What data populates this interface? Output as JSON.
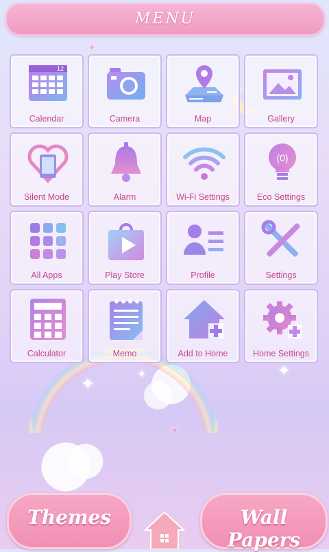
{
  "header": {
    "title": "MENU"
  },
  "tiles": [
    {
      "label": "Calendar",
      "icon": "calendar-icon",
      "badge": "12"
    },
    {
      "label": "Camera",
      "icon": "camera-icon"
    },
    {
      "label": "Map",
      "icon": "map-icon"
    },
    {
      "label": "Gallery",
      "icon": "gallery-icon"
    },
    {
      "label": "Silent Mode",
      "icon": "silent-mode-icon"
    },
    {
      "label": "Alarm",
      "icon": "alarm-bell-icon"
    },
    {
      "label": "Wi-Fi Settings",
      "icon": "wifi-icon"
    },
    {
      "label": "Eco Settings",
      "icon": "eco-bulb-icon"
    },
    {
      "label": "All Apps",
      "icon": "all-apps-icon"
    },
    {
      "label": "Play Store",
      "icon": "play-store-icon"
    },
    {
      "label": "Profile",
      "icon": "profile-icon"
    },
    {
      "label": "Settings",
      "icon": "settings-tools-icon"
    },
    {
      "label": "Calculator",
      "icon": "calculator-icon"
    },
    {
      "label": "Memo",
      "icon": "memo-icon"
    },
    {
      "label": "Add to Home",
      "icon": "add-to-home-icon"
    },
    {
      "label": "Home Settings",
      "icon": "home-settings-icon"
    }
  ],
  "footer": {
    "themes_label": "Themes",
    "wallpapers_label": "Wall Papers",
    "home_icon": "home-icon"
  },
  "colors": {
    "accent_pink": "#f09bc3",
    "label_pink": "#c8478c",
    "icon_purple": "#a47ee8",
    "icon_blue": "#7fb6f0"
  }
}
